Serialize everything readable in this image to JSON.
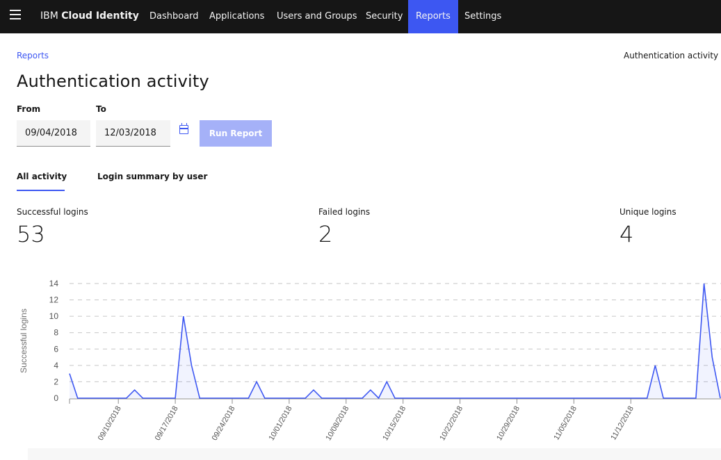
{
  "nav": {
    "brand_prefix": "IBM",
    "brand_name": "Cloud Identity",
    "items": [
      {
        "label": "Dashboard",
        "active": false
      },
      {
        "label": "Applications",
        "active": false
      },
      {
        "label": "Users and Groups",
        "active": false
      },
      {
        "label": "Security",
        "active": false
      },
      {
        "label": "Reports",
        "active": true
      },
      {
        "label": "Settings",
        "active": false
      }
    ]
  },
  "breadcrumb": "Reports",
  "right_link": "Authentication activity f",
  "page_title": "Authentication activity",
  "form": {
    "from_label": "From",
    "to_label": "To",
    "from_value": "09/04/2018",
    "to_value": "12/03/2018",
    "run_button": "Run Report"
  },
  "tabs": [
    {
      "label": "All activity",
      "active": true
    },
    {
      "label": "Login summary by user",
      "active": false
    }
  ],
  "stats": [
    {
      "label": "Successful logins",
      "value": "53"
    },
    {
      "label": "Failed logins",
      "value": "2"
    },
    {
      "label": "Unique logins",
      "value": "4"
    }
  ],
  "colors": {
    "accent": "#3d57f2",
    "topbar": "#161616",
    "button_disabled": "#a5b1f8"
  },
  "chart_data": {
    "type": "line",
    "ylabel": "Successful logins",
    "xlabel": "",
    "ylim": [
      0,
      14
    ],
    "y_ticks": [
      0,
      2,
      4,
      6,
      8,
      10,
      12,
      14
    ],
    "x_tick_labels": [
      "09/10/2018",
      "09/17/2018",
      "09/24/2018",
      "10/01/2018",
      "10/08/2018",
      "10/15/2018",
      "10/22/2018",
      "10/29/2018",
      "11/05/2018",
      "11/12/2018"
    ],
    "x_start": "2018-09-04",
    "series": [
      {
        "values": [
          3,
          0,
          0,
          0,
          0,
          0,
          0,
          0,
          1,
          0,
          0,
          0,
          0,
          0,
          10,
          4,
          0,
          0,
          0,
          0,
          0,
          0,
          0,
          2,
          0,
          0,
          0,
          0,
          0,
          0,
          1,
          0,
          0,
          0,
          0,
          0,
          0,
          1,
          0,
          2,
          0,
          0,
          0,
          0,
          0,
          0,
          0,
          0,
          0,
          0,
          0,
          0,
          0,
          0,
          0,
          0,
          0,
          0,
          0,
          0,
          0,
          0,
          0,
          0,
          0,
          0,
          0,
          0,
          0,
          0,
          0,
          0,
          4,
          0,
          0,
          0,
          0,
          0,
          14,
          5,
          0
        ]
      }
    ],
    "grid": true,
    "grid_style": "dashed"
  }
}
